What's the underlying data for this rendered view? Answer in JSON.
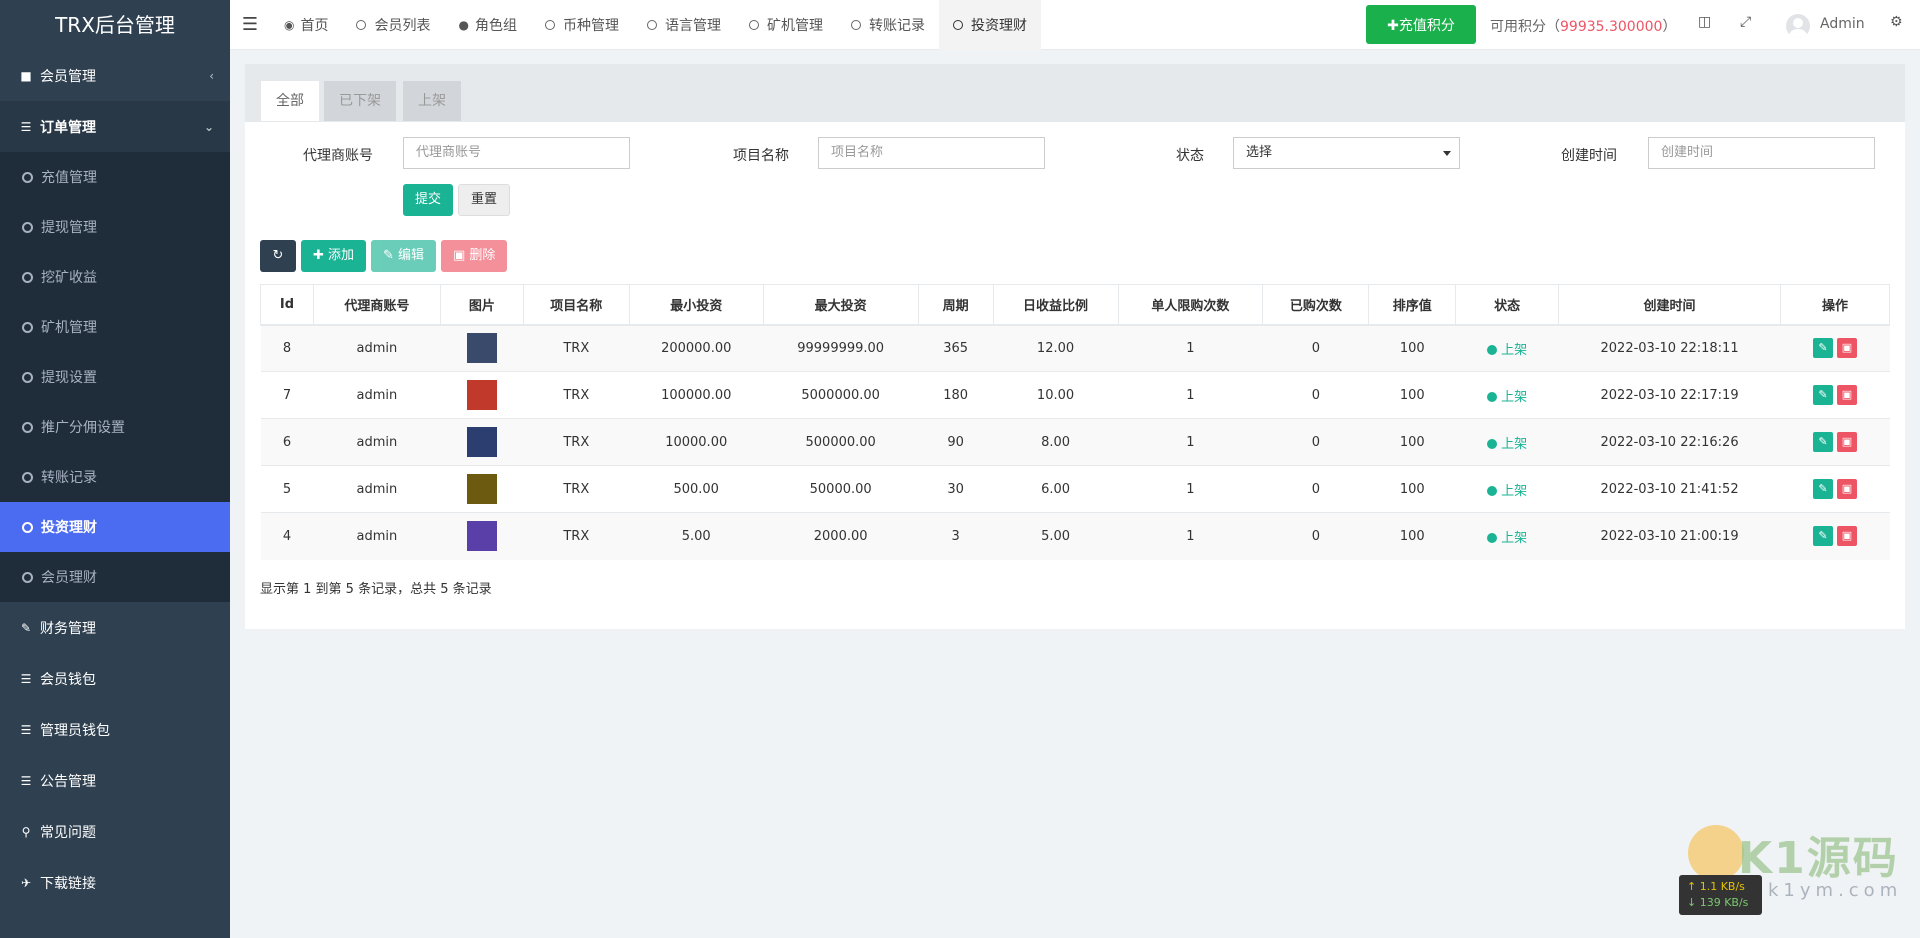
{
  "app": {
    "title": "TRX后台管理"
  },
  "sidebar": {
    "items_top": [
      {
        "label": "会员管理",
        "icon": "user-icon"
      },
      {
        "label": "订单管理",
        "icon": "list-icon"
      }
    ],
    "sub_items": [
      {
        "label": "充值管理"
      },
      {
        "label": "提现管理"
      },
      {
        "label": "挖矿收益"
      },
      {
        "label": "矿机管理"
      },
      {
        "label": "提现设置"
      },
      {
        "label": "推广分佣设置"
      },
      {
        "label": "转账记录"
      },
      {
        "label": "投资理财"
      },
      {
        "label": "会员理财"
      }
    ],
    "items_bottom": [
      {
        "label": "财务管理",
        "icon": "edit-icon"
      },
      {
        "label": "会员钱包",
        "icon": "list-icon"
      },
      {
        "label": "管理员钱包",
        "icon": "list-icon"
      },
      {
        "label": "公告管理",
        "icon": "list-icon"
      },
      {
        "label": "常见问题",
        "icon": "search-icon"
      },
      {
        "label": "下载链接",
        "icon": "plane-icon"
      }
    ]
  },
  "topbar": {
    "tabs": [
      {
        "label": "首页",
        "icon": "dashboard-icon"
      },
      {
        "label": "会员列表"
      },
      {
        "label": "角色组",
        "icon": "users-icon"
      },
      {
        "label": "币种管理"
      },
      {
        "label": "语言管理"
      },
      {
        "label": "矿机管理"
      },
      {
        "label": "转账记录"
      },
      {
        "label": "投资理财"
      }
    ],
    "recharge_label": "✚充值积分",
    "points_label": "可用积分（",
    "points_value": "99935.300000",
    "points_suffix": "）",
    "username": "Admin"
  },
  "filter_tabs": [
    "全部",
    "已下架",
    "上架"
  ],
  "filters": {
    "agent_label": "代理商账号",
    "agent_placeholder": "代理商账号",
    "project_label": "项目名称",
    "project_placeholder": "项目名称",
    "status_label": "状态",
    "status_value": "选择",
    "created_label": "创建时间",
    "created_placeholder": "创建时间",
    "submit_label": "提交",
    "reset_label": "重置"
  },
  "toolbar": {
    "add_label": "添加",
    "edit_label": "编辑",
    "delete_label": "删除"
  },
  "table": {
    "columns": [
      "Id",
      "代理商账号",
      "图片",
      "项目名称",
      "最小投资",
      "最大投资",
      "周期",
      "日收益比例",
      "单人限购次数",
      "已购次数",
      "排序值",
      "状态",
      "创建时间",
      "操作"
    ],
    "rows": [
      {
        "id": "8",
        "agent": "admin",
        "thumb_color": "#3a4a6a",
        "name": "TRX",
        "min": "200000.00",
        "max": "99999999.00",
        "period": "365",
        "rate": "12.00",
        "limit": "1",
        "bought": "0",
        "sort": "100",
        "status": "上架",
        "created": "2022-03-10 22:18:11"
      },
      {
        "id": "7",
        "agent": "admin",
        "thumb_color": "#c0392b",
        "name": "TRX",
        "min": "100000.00",
        "max": "5000000.00",
        "period": "180",
        "rate": "10.00",
        "limit": "1",
        "bought": "0",
        "sort": "100",
        "status": "上架",
        "created": "2022-03-10 22:17:19"
      },
      {
        "id": "6",
        "agent": "admin",
        "thumb_color": "#2c3e70",
        "name": "TRX",
        "min": "10000.00",
        "max": "500000.00",
        "period": "90",
        "rate": "8.00",
        "limit": "1",
        "bought": "0",
        "sort": "100",
        "status": "上架",
        "created": "2022-03-10 22:16:26"
      },
      {
        "id": "5",
        "agent": "admin",
        "thumb_color": "#6b5a10",
        "name": "TRX",
        "min": "500.00",
        "max": "50000.00",
        "period": "30",
        "rate": "6.00",
        "limit": "1",
        "bought": "0",
        "sort": "100",
        "status": "上架",
        "created": "2022-03-10 21:41:52"
      },
      {
        "id": "4",
        "agent": "admin",
        "thumb_color": "#5b3fa8",
        "name": "TRX",
        "min": "5.00",
        "max": "2000.00",
        "period": "3",
        "rate": "5.00",
        "limit": "1",
        "bought": "0",
        "sort": "100",
        "status": "上架",
        "created": "2022-03-10 21:00:19"
      }
    ]
  },
  "pagination": {
    "info": "显示第 1 到第 5 条记录，总共 5 条记录"
  },
  "watermark": {
    "brand": "K1源码",
    "url": "k1ym.com"
  },
  "netspeed": {
    "up": "↑ 1.1 KB/s",
    "down": "↓ 139 KB/s"
  },
  "colors": {
    "sidebar": "#2f4050",
    "accent": "#1ab394",
    "active_menu": "#4b6cf0",
    "danger": "#ed5565",
    "recharge": "#1ab04b"
  }
}
